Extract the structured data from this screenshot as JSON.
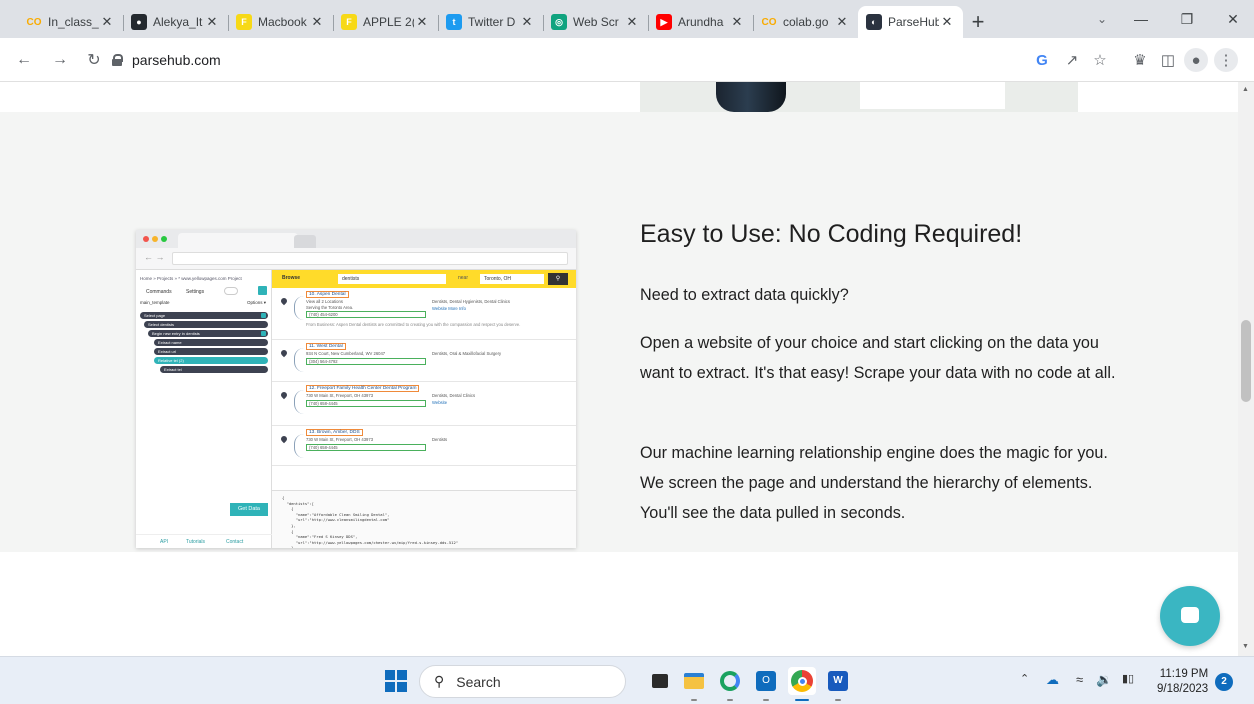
{
  "browser": {
    "tabs": [
      {
        "label": "In_class_",
        "icon": "colab-icon",
        "color": "#f9ab00",
        "glyph": "CO"
      },
      {
        "label": "Alekya_It",
        "icon": "github-icon",
        "color": "#24292f",
        "glyph": "●"
      },
      {
        "label": "Macbook",
        "icon": "flipkart-icon",
        "color": "#f7d917",
        "glyph": "F"
      },
      {
        "label": "APPLE 2(",
        "icon": "flipkart-icon",
        "color": "#f7d917",
        "glyph": "F"
      },
      {
        "label": "Twitter D",
        "icon": "twitter-icon",
        "color": "#1d9bf0",
        "glyph": "t"
      },
      {
        "label": "Web Scr",
        "icon": "chatgpt-icon",
        "color": "#10a37f",
        "glyph": "◎"
      },
      {
        "label": "Arundha",
        "icon": "youtube-icon",
        "color": "#ff0000",
        "glyph": "▶"
      },
      {
        "label": "colab.go",
        "icon": "colab-icon",
        "color": "#f9ab00",
        "glyph": "CO"
      },
      {
        "label": "ParseHub",
        "icon": "parsehub-icon",
        "color": "#2b3340",
        "glyph": "◐",
        "active": true
      }
    ],
    "url": "parsehub.com"
  },
  "hero": {
    "heading": "Easy to Use: No Coding Required!",
    "p1": "Need to extract data quickly?",
    "p2": "Open a website of your choice and start clicking on the data you want to extract. It's that easy! Scrape your data with no code at all.",
    "p3": "Our machine learning relationship engine does the magic for you. We screen the page and understand the hierarchy of elements. You'll see the data pulled in seconds."
  },
  "demo": {
    "crumb": "Home » Projects » * www.yellowpages.com Project",
    "commands": "Commands",
    "settings": "Settings",
    "template_label": "main_template",
    "options": "Options ▾",
    "rows": [
      {
        "text": "Select page",
        "style": "dark",
        "plus": true
      },
      {
        "text": "Select dentists",
        "style": "dark",
        "plus": false
      },
      {
        "text": "Begin new entry in dentists",
        "style": "dark",
        "plus": true
      },
      {
        "text": "Extract name",
        "style": "dark",
        "plus": false
      },
      {
        "text": "Extract url",
        "style": "dark",
        "plus": false
      },
      {
        "text": "Relative tel (2)",
        "style": "teal",
        "plus": false
      },
      {
        "text": "Extract tel",
        "style": "dark",
        "plus": false
      }
    ],
    "get_data": "Get Data",
    "footer": [
      "API",
      "Tutorials",
      "Contact"
    ],
    "browse": "Browse",
    "search_value": "dentists",
    "near": "near",
    "location_value": "Toronto, OH",
    "results": [
      {
        "name": "10. Aspen Dental",
        "line1": "View all 2 Locations",
        "line2": "Serving the Toronto Area.",
        "phone": "(740) 454-6200",
        "category": "Dentists, Dental Hygienists, Dental Clinics",
        "links": "Website  More Info",
        "desc": "From Business: Aspen Dental dentists are committed to creating you with the compassion and respect you deserve."
      },
      {
        "name": "11. West Dental",
        "line1": "934 N Court, New Cumberland, WV 26047",
        "line2": "",
        "phone": "(304) 564-4792",
        "category": "Dentists, Oral & Maxillofacial Surgery",
        "links": "",
        "desc": ""
      },
      {
        "name": "12. Freeport Family Health Center Dental Program",
        "line1": "730 W Main St, Freeport, OH 43973",
        "line2": "",
        "phone": "(740) 658-4445",
        "category": "Dentists, Dental Clinics",
        "links": "Website",
        "desc": ""
      },
      {
        "name": "13. Brown, Amber, DDS",
        "line1": "730 W Main St, Freeport, OH 43973",
        "line2": "",
        "phone": "(740) 658-4445",
        "category": "Dentists",
        "links": "",
        "desc": ""
      }
    ],
    "json_text": "{\n  \"dentists\":[\n    {\n      \"name\":\"Affordable Clean Smiling Dental\",\n      \"url\":\"http://www.cleansmilingdental.com\"\n    },\n    {\n      \"name\":\"Fred S Kinsey DDS\",\n      \"url\":\"http://www.yellowpages.com/chester-wv/mip/fred-s-kinsey-dds-512\"\n    },"
  },
  "taskbar": {
    "search_label": "Search",
    "time": "11:19 PM",
    "date": "9/18/2023",
    "notifications": "2"
  }
}
